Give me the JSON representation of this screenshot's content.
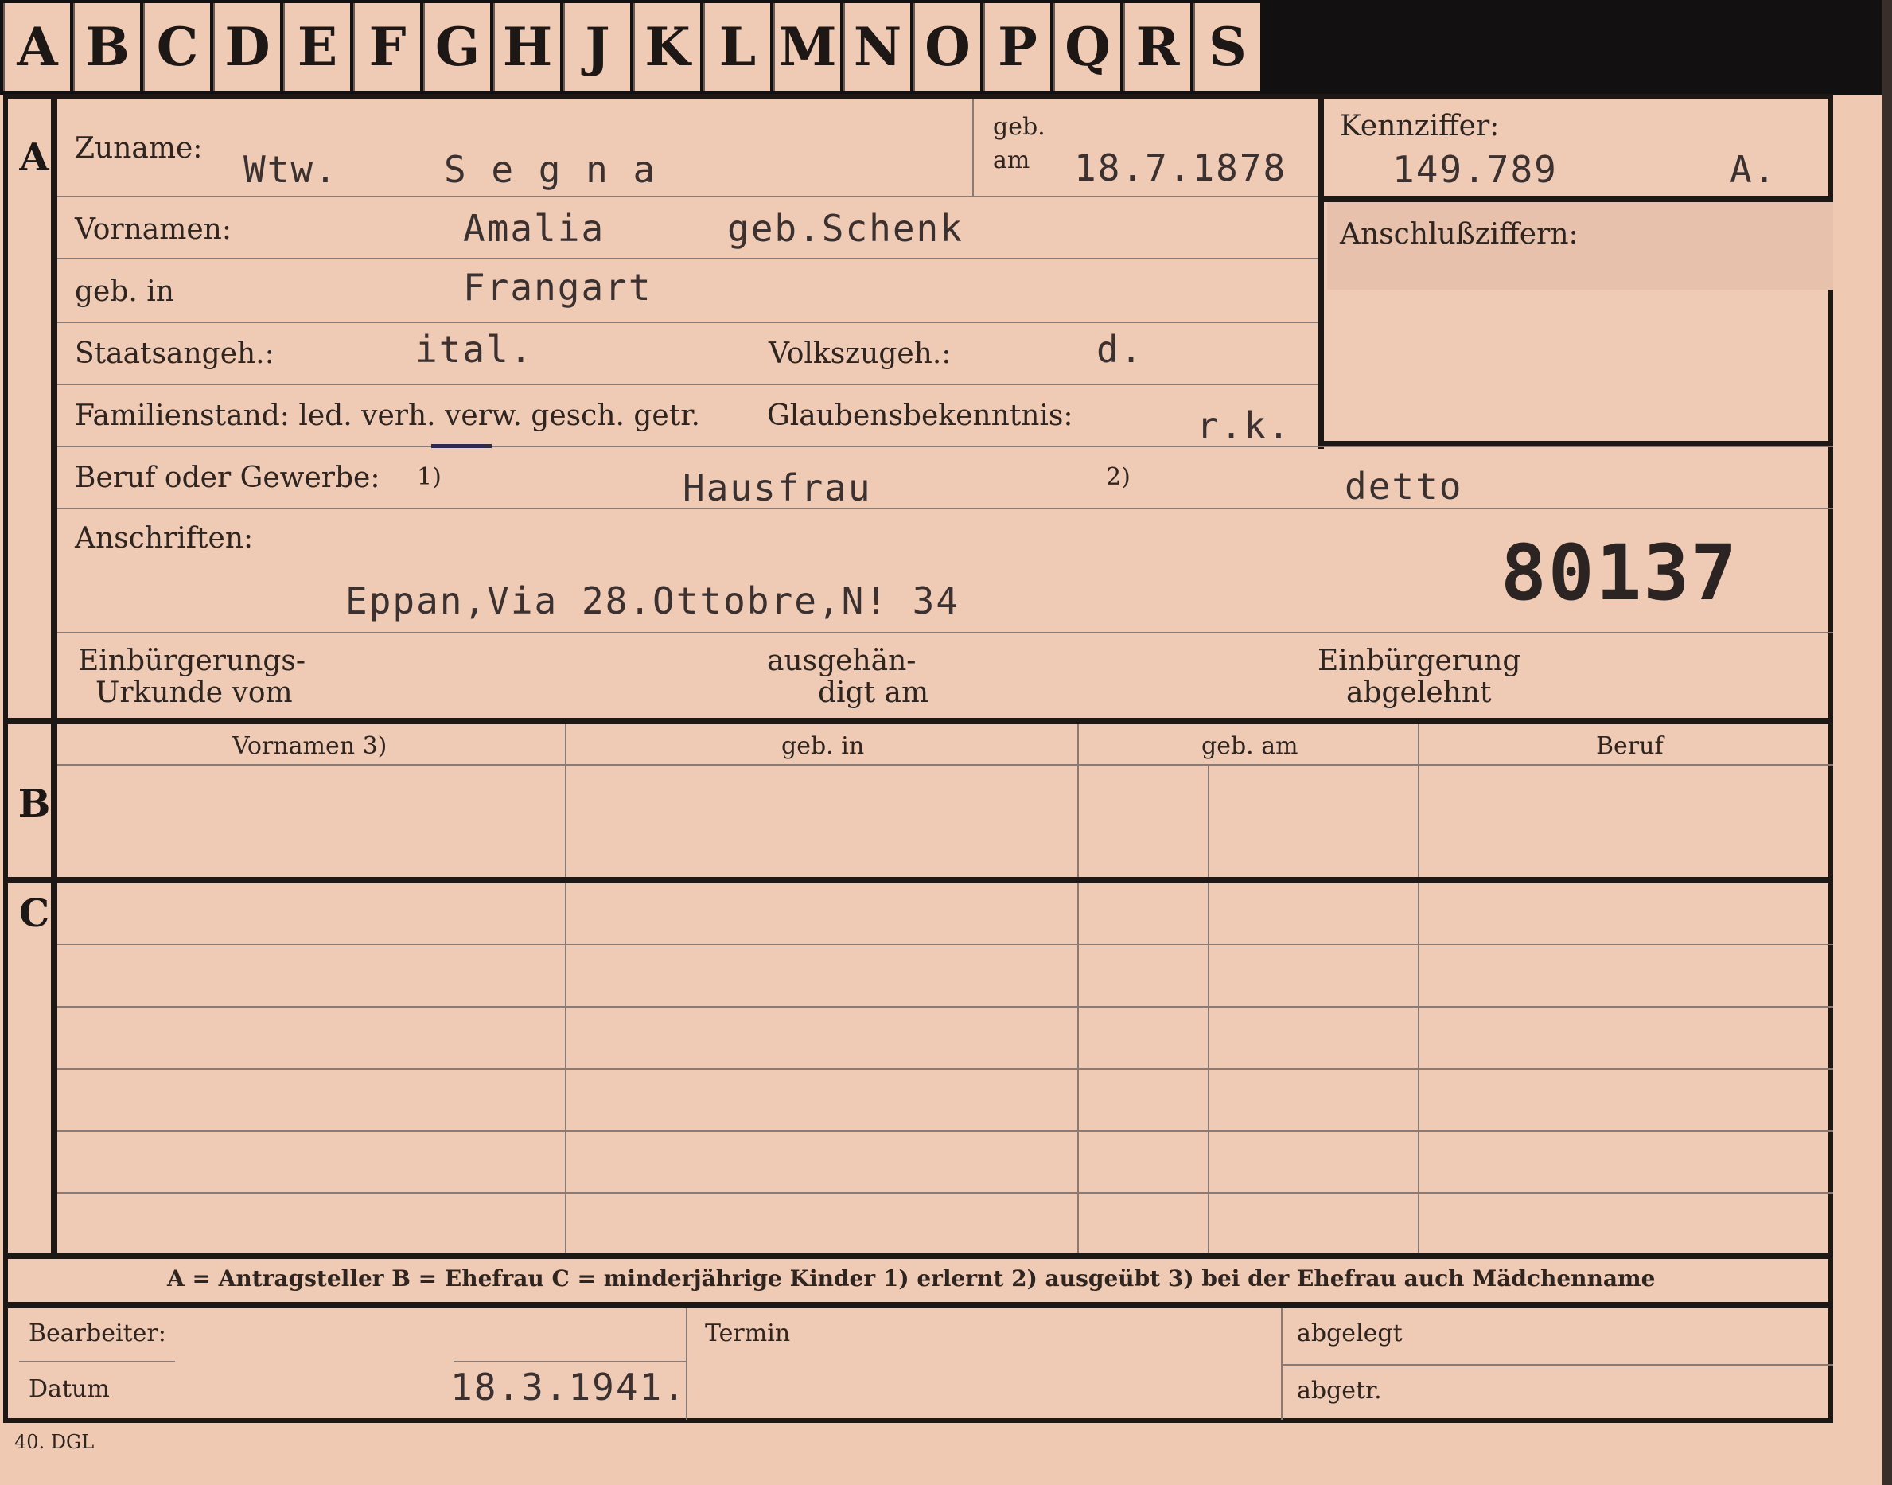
{
  "tabs": [
    "A",
    "B",
    "C",
    "D",
    "E",
    "F",
    "G",
    "H",
    "J",
    "K",
    "L",
    "M",
    "N",
    "O",
    "P",
    "Q",
    "R",
    "S"
  ],
  "section_letters": {
    "a": "A",
    "b": "B",
    "c": "C"
  },
  "labels": {
    "zuname": "Zuname:",
    "geb": "geb.",
    "am": "am",
    "kennziffer": "Kennziffer:",
    "vornamen": "Vornamen:",
    "anschlussziffern": "Anschlußziffern:",
    "geb_in": "geb. in",
    "staatsangeh": "Staatsangeh.:",
    "volkszugeh": "Volkszugeh.:",
    "familienstand": "Familienstand: led. verh. verw. gesch. getr.",
    "glaubensbekenntnis": "Glaubensbekenntnis:",
    "beruf": "Beruf oder Gewerbe:",
    "fn1": "1)",
    "fn2": "2)",
    "anschriften": "Anschriften:",
    "einbuergerung_urkunde_1": "Einbürgerungs-",
    "einbuergerung_urkunde_2": "Urkunde vom",
    "ausgehaendigt_1": "ausgehän-",
    "ausgehaendigt_2": "digt am",
    "einbuergerung_abgelehnt_1": "Einbürgerung",
    "einbuergerung_abgelehnt_2": "abgelehnt",
    "bearbeiter": "Bearbeiter:",
    "termin": "Termin",
    "abgelegt": "abgelegt",
    "datum": "Datum",
    "abgetr": "abgetr.",
    "form_code": "40. DGL"
  },
  "table_headers": [
    "Vornamen 3)",
    "geb. in",
    "geb. am",
    "Beruf"
  ],
  "legend": "A = Antragsteller   B = Ehefrau   C = minderjährige Kinder   1) erlernt   2) ausgeübt   3) bei der Ehefrau auch Mädchenname",
  "values": {
    "zuname_prefix": "Wtw.",
    "zuname": "S e g n a",
    "geb_am": "18.7.1878",
    "kennziffer": "149.789",
    "kennziffer_suffix": "A.",
    "vornamen": "Amalia",
    "geb_name": "geb.Schenk",
    "geb_in": "Frangart",
    "staatsangeh": "ital.",
    "volkszugeh": "d.",
    "glaubensbekenntnis": "r.k.",
    "beruf_erlernt": "Hausfrau",
    "beruf_ausgeuebt": "detto",
    "anschrift": "Eppan,Via 28.Ottobre,N! 34",
    "stamp_number": "80137",
    "datum": "18.3.1941."
  }
}
